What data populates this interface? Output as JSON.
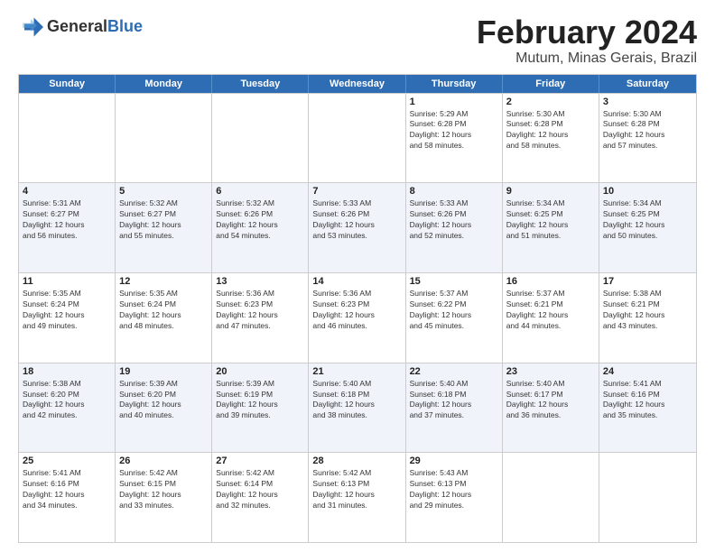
{
  "logo": {
    "general": "General",
    "blue": "Blue"
  },
  "title": "February 2024",
  "location": "Mutum, Minas Gerais, Brazil",
  "days_of_week": [
    "Sunday",
    "Monday",
    "Tuesday",
    "Wednesday",
    "Thursday",
    "Friday",
    "Saturday"
  ],
  "weeks": [
    [
      {
        "day": "",
        "info": ""
      },
      {
        "day": "",
        "info": ""
      },
      {
        "day": "",
        "info": ""
      },
      {
        "day": "",
        "info": ""
      },
      {
        "day": "1",
        "info": "Sunrise: 5:29 AM\nSunset: 6:28 PM\nDaylight: 12 hours\nand 58 minutes."
      },
      {
        "day": "2",
        "info": "Sunrise: 5:30 AM\nSunset: 6:28 PM\nDaylight: 12 hours\nand 58 minutes."
      },
      {
        "day": "3",
        "info": "Sunrise: 5:30 AM\nSunset: 6:28 PM\nDaylight: 12 hours\nand 57 minutes."
      }
    ],
    [
      {
        "day": "4",
        "info": "Sunrise: 5:31 AM\nSunset: 6:27 PM\nDaylight: 12 hours\nand 56 minutes."
      },
      {
        "day": "5",
        "info": "Sunrise: 5:32 AM\nSunset: 6:27 PM\nDaylight: 12 hours\nand 55 minutes."
      },
      {
        "day": "6",
        "info": "Sunrise: 5:32 AM\nSunset: 6:26 PM\nDaylight: 12 hours\nand 54 minutes."
      },
      {
        "day": "7",
        "info": "Sunrise: 5:33 AM\nSunset: 6:26 PM\nDaylight: 12 hours\nand 53 minutes."
      },
      {
        "day": "8",
        "info": "Sunrise: 5:33 AM\nSunset: 6:26 PM\nDaylight: 12 hours\nand 52 minutes."
      },
      {
        "day": "9",
        "info": "Sunrise: 5:34 AM\nSunset: 6:25 PM\nDaylight: 12 hours\nand 51 minutes."
      },
      {
        "day": "10",
        "info": "Sunrise: 5:34 AM\nSunset: 6:25 PM\nDaylight: 12 hours\nand 50 minutes."
      }
    ],
    [
      {
        "day": "11",
        "info": "Sunrise: 5:35 AM\nSunset: 6:24 PM\nDaylight: 12 hours\nand 49 minutes."
      },
      {
        "day": "12",
        "info": "Sunrise: 5:35 AM\nSunset: 6:24 PM\nDaylight: 12 hours\nand 48 minutes."
      },
      {
        "day": "13",
        "info": "Sunrise: 5:36 AM\nSunset: 6:23 PM\nDaylight: 12 hours\nand 47 minutes."
      },
      {
        "day": "14",
        "info": "Sunrise: 5:36 AM\nSunset: 6:23 PM\nDaylight: 12 hours\nand 46 minutes."
      },
      {
        "day": "15",
        "info": "Sunrise: 5:37 AM\nSunset: 6:22 PM\nDaylight: 12 hours\nand 45 minutes."
      },
      {
        "day": "16",
        "info": "Sunrise: 5:37 AM\nSunset: 6:21 PM\nDaylight: 12 hours\nand 44 minutes."
      },
      {
        "day": "17",
        "info": "Sunrise: 5:38 AM\nSunset: 6:21 PM\nDaylight: 12 hours\nand 43 minutes."
      }
    ],
    [
      {
        "day": "18",
        "info": "Sunrise: 5:38 AM\nSunset: 6:20 PM\nDaylight: 12 hours\nand 42 minutes."
      },
      {
        "day": "19",
        "info": "Sunrise: 5:39 AM\nSunset: 6:20 PM\nDaylight: 12 hours\nand 40 minutes."
      },
      {
        "day": "20",
        "info": "Sunrise: 5:39 AM\nSunset: 6:19 PM\nDaylight: 12 hours\nand 39 minutes."
      },
      {
        "day": "21",
        "info": "Sunrise: 5:40 AM\nSunset: 6:18 PM\nDaylight: 12 hours\nand 38 minutes."
      },
      {
        "day": "22",
        "info": "Sunrise: 5:40 AM\nSunset: 6:18 PM\nDaylight: 12 hours\nand 37 minutes."
      },
      {
        "day": "23",
        "info": "Sunrise: 5:40 AM\nSunset: 6:17 PM\nDaylight: 12 hours\nand 36 minutes."
      },
      {
        "day": "24",
        "info": "Sunrise: 5:41 AM\nSunset: 6:16 PM\nDaylight: 12 hours\nand 35 minutes."
      }
    ],
    [
      {
        "day": "25",
        "info": "Sunrise: 5:41 AM\nSunset: 6:16 PM\nDaylight: 12 hours\nand 34 minutes."
      },
      {
        "day": "26",
        "info": "Sunrise: 5:42 AM\nSunset: 6:15 PM\nDaylight: 12 hours\nand 33 minutes."
      },
      {
        "day": "27",
        "info": "Sunrise: 5:42 AM\nSunset: 6:14 PM\nDaylight: 12 hours\nand 32 minutes."
      },
      {
        "day": "28",
        "info": "Sunrise: 5:42 AM\nSunset: 6:13 PM\nDaylight: 12 hours\nand 31 minutes."
      },
      {
        "day": "29",
        "info": "Sunrise: 5:43 AM\nSunset: 6:13 PM\nDaylight: 12 hours\nand 29 minutes."
      },
      {
        "day": "",
        "info": ""
      },
      {
        "day": "",
        "info": ""
      }
    ]
  ]
}
